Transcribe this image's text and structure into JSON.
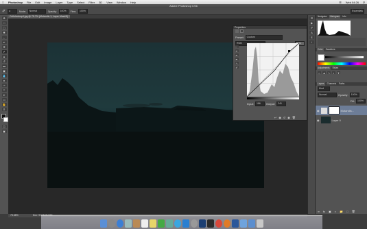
{
  "menubar": {
    "apple": "",
    "app": "Photoshop",
    "items": [
      "File",
      "Edit",
      "Image",
      "Layer",
      "Type",
      "Select",
      "Filter",
      "3D",
      "View",
      "Window",
      "Help"
    ],
    "clock": "Wed 04:26"
  },
  "window": {
    "title": "Adobe Photoshop CS6"
  },
  "options": {
    "mode_label": "Mode:",
    "mode_value": "Normal",
    "opacity_label": "Opacity:",
    "opacity_value": "100%",
    "flow_label": "Flow:",
    "flow_value": "100%",
    "workspace": "Essentials"
  },
  "document": {
    "tab": "Cellulardrop4.jpg @ 75.7% (Mutandis 1, Layer Mask/8) *"
  },
  "properties": {
    "header": "Properties",
    "preset_label": "Preset:",
    "preset_value": "Custom",
    "channel_value": "RGB",
    "auto_label": "Auto",
    "input_label": "Input:",
    "input_value": "186",
    "output_label": "Output:",
    "output_value": "241"
  },
  "right": {
    "tabs_top": [
      "Navigator",
      "Histogram",
      "Info"
    ],
    "tabs_mid": [
      "Color",
      "Swatches"
    ],
    "tabs_adj": [
      "Adjustments",
      "Styles"
    ],
    "tabs_layers": [
      "Layers",
      "Channels",
      "Paths"
    ],
    "kind_label": "Kind",
    "blend_value": "Normal",
    "opacity_label": "Opacity:",
    "opacity_value": "100%",
    "fill_label": "Fill:",
    "fill_value": "100%",
    "layers": [
      {
        "name": "Mutandis..."
      },
      {
        "name": "Layer 0"
      }
    ]
  },
  "status": {
    "zoom": "75.68%",
    "doc": "Doc: 3.67M/8.02M"
  },
  "colors": {
    "accent": "#2d5da8"
  }
}
